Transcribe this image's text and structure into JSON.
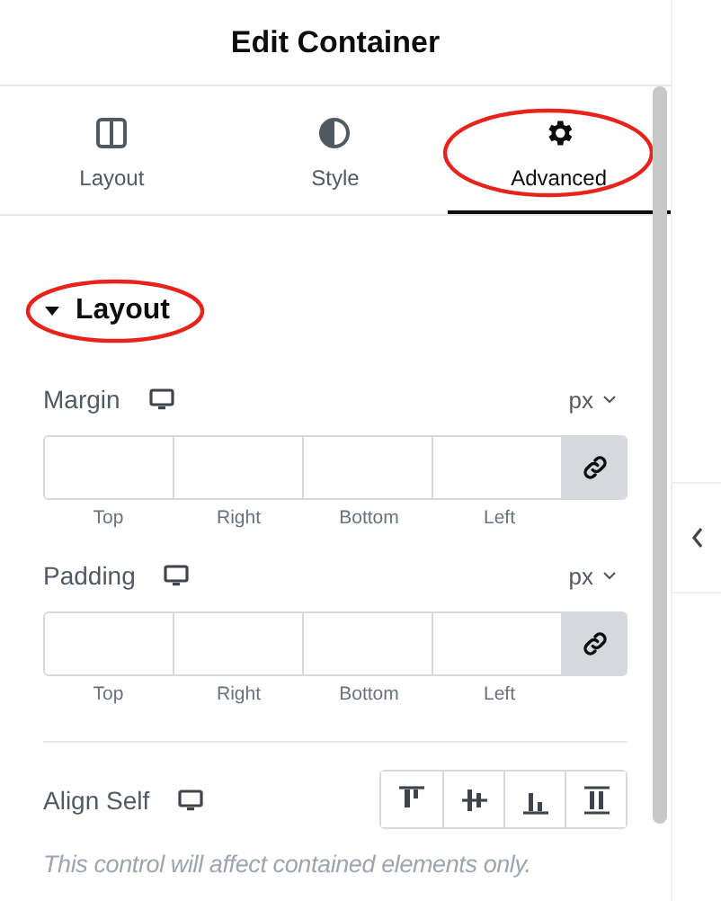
{
  "header": {
    "title": "Edit Container"
  },
  "tabs": [
    {
      "label": "Layout",
      "kind": "columns",
      "selected": false,
      "circled": false
    },
    {
      "label": "Style",
      "kind": "contrast",
      "selected": false,
      "circled": false
    },
    {
      "label": "Advanced",
      "kind": "gear",
      "selected": true,
      "circled": true
    }
  ],
  "section": {
    "title": "Layout",
    "expanded": true,
    "circled": true
  },
  "dimension_controls": [
    {
      "label": "Margin",
      "unit": "px",
      "linked": true,
      "sides": [
        "Top",
        "Right",
        "Bottom",
        "Left"
      ]
    },
    {
      "label": "Padding",
      "unit": "px",
      "linked": true,
      "sides": [
        "Top",
        "Right",
        "Bottom",
        "Left"
      ]
    }
  ],
  "align_self": {
    "label": "Align Self",
    "options": [
      {
        "kind": "start",
        "selected": false
      },
      {
        "kind": "center",
        "selected": false
      },
      {
        "kind": "end",
        "selected": false
      },
      {
        "kind": "stretch",
        "selected": false
      }
    ]
  },
  "note": "This control will affect contained elements only."
}
